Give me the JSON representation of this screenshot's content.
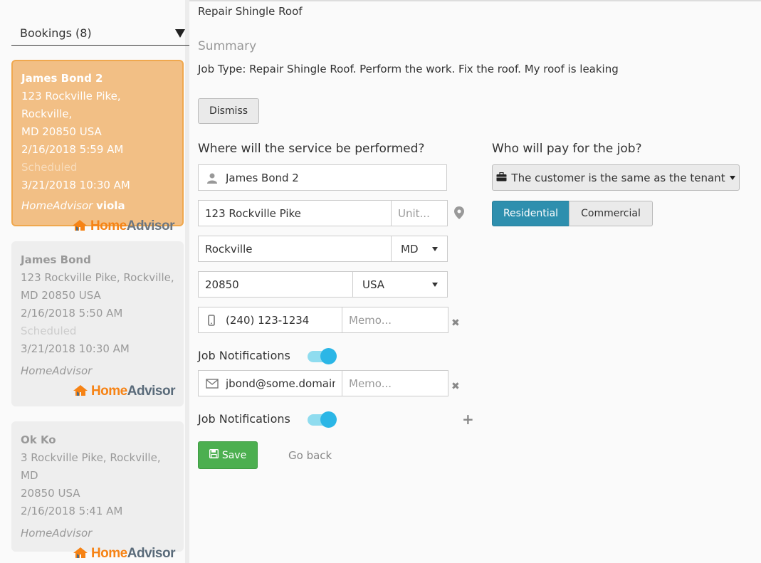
{
  "sidebar": {
    "bookings_title": "Bookings (8)",
    "cards": [
      {
        "name": "James Bond 2",
        "address_line1": "123 Rockville Pike, Rockville,",
        "address_line2": "MD 20850 USA",
        "created": "2/16/2018 5:59 AM",
        "status": "Scheduled",
        "scheduled_time": "3/21/2018 10:30 AM",
        "source": "HomeAdvisor",
        "source_user": "viola",
        "logo_home": "Home",
        "logo_advisor": "Advisor"
      },
      {
        "name": "James Bond",
        "address_line1": "123 Rockville Pike, Rockville,",
        "address_line2": "MD 20850 USA",
        "created": "2/16/2018 5:50 AM",
        "status": "Scheduled",
        "scheduled_time": "3/21/2018 10:30 AM",
        "source": "HomeAdvisor",
        "logo_home": "Home",
        "logo_advisor": "Advisor"
      },
      {
        "name": "Ok Ko",
        "address_line1": "3 Rockville Pike, Rockville, MD",
        "address_line2": "20850 USA",
        "created": "2/16/2018 5:41 AM",
        "source": "HomeAdvisor",
        "logo_home": "Home",
        "logo_advisor": "Advisor"
      }
    ]
  },
  "main": {
    "job_title": "Repair Shingle Roof",
    "summary_heading": "Summary",
    "summary_text": "Job Type: Repair Shingle Roof. Perform the work. Fix the roof. My roof is leaking",
    "dismiss_label": "Dismiss",
    "service_heading": "Where will the service be performed?",
    "payer_heading": "Who will pay for the job?",
    "contact_name": "James Bond 2",
    "street": "123 Rockville Pike",
    "unit_placeholder": "Unit...",
    "city": "Rockville",
    "state": "MD",
    "zip": "20850",
    "country": "USA",
    "phone": "(240) 123-1234",
    "memo_placeholder": "Memo...",
    "email": "jbond@some.domain",
    "job_notifications_label": "Job Notifications",
    "save_label": "Save",
    "go_back_label": "Go back",
    "payer_option": "The customer is the same as the tenant",
    "residential_label": "Residential",
    "commercial_label": "Commercial"
  },
  "icons": {
    "person": "person-icon",
    "map_marker": "map-marker-icon",
    "mobile": "mobile-phone-icon",
    "envelope": "envelope-icon",
    "remove": "remove-icon",
    "plus": "plus-icon",
    "briefcase": "briefcase-icon",
    "floppy": "floppy-disk-icon"
  },
  "colors": {
    "active_card_bg": "#f2bf85",
    "active_card_border": "#f0a84e",
    "toggle_on": "#2bb6e6",
    "save_green": "#4caf50",
    "residential_blue": "#2e8fae"
  }
}
